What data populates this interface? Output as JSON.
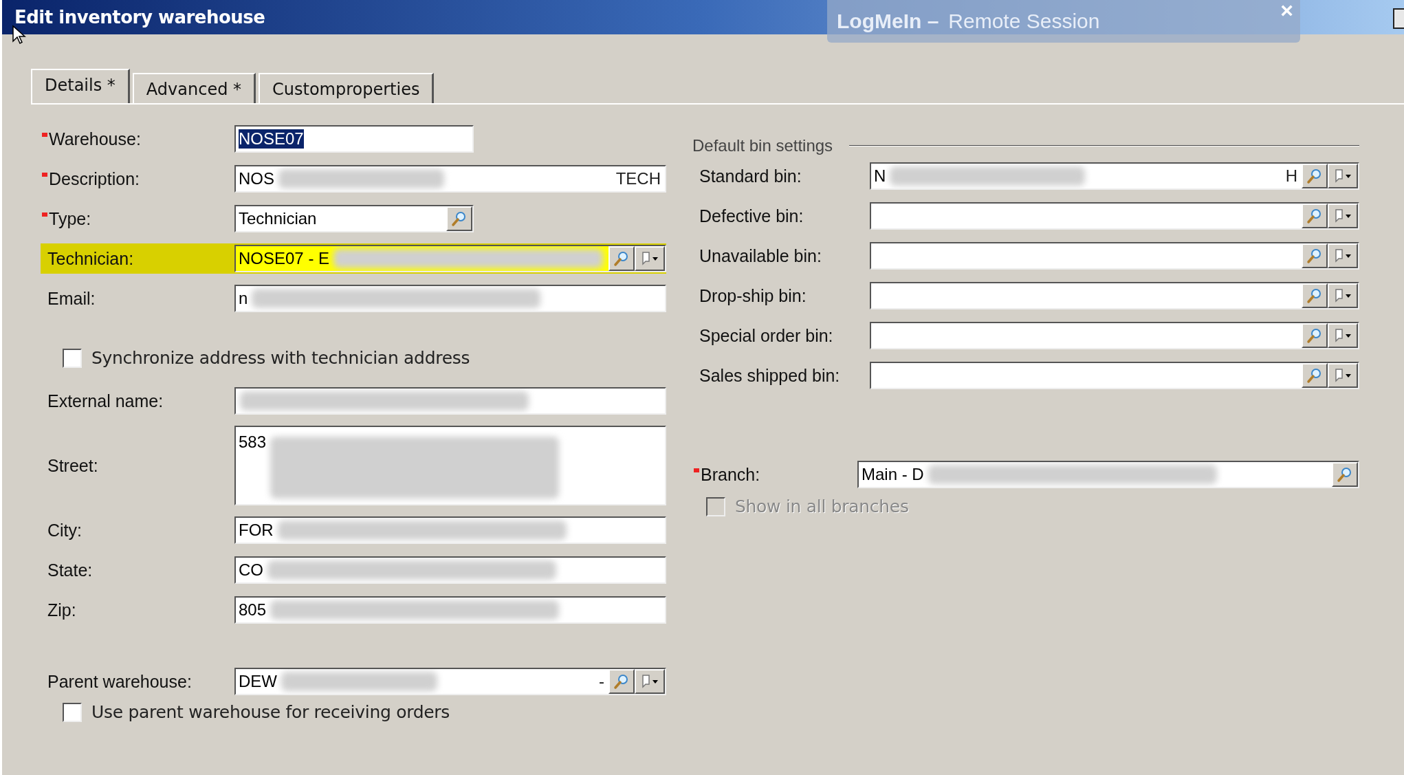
{
  "window": {
    "title": "Edit inventory warehouse"
  },
  "remote_overlay": {
    "brand": "LogMeIn –",
    "subtitle": "Remote Session",
    "close": "×"
  },
  "tabs": [
    {
      "label": "Details *",
      "selected": true
    },
    {
      "label": "Advanced *",
      "selected": false
    },
    {
      "label": "Customproperties",
      "selected": false
    }
  ],
  "primary_fields": [
    {
      "kind": "short",
      "label": "Warehouse:",
      "required": true,
      "value": "NOSE07",
      "value_selected": true
    },
    {
      "kind": "text",
      "label": "Description:",
      "required": true,
      "value": "NOS",
      "value_end": "TECH",
      "redacted": true
    },
    {
      "kind": "short_lookup",
      "label": "Type:",
      "required": true,
      "value": "Technician"
    },
    {
      "kind": "lookup_menu",
      "label": "Technician:",
      "value": "NOSE07 - E",
      "highlighted": true,
      "redacted": true
    },
    {
      "kind": "text",
      "label": "Email:",
      "value": "n",
      "redacted": true
    }
  ],
  "sync_checkbox": {
    "label": "Synchronize address with technician address",
    "checked": false
  },
  "address_fields": [
    {
      "kind": "text",
      "label": "External name:",
      "redacted": true
    },
    {
      "kind": "multiline",
      "label": "Street:",
      "value": "583",
      "redacted": true
    },
    {
      "kind": "text",
      "label": "City:",
      "value": "FOR",
      "redacted": true
    },
    {
      "kind": "text",
      "label": "State:",
      "value": "CO",
      "redacted": true
    },
    {
      "kind": "text",
      "label": "Zip:",
      "value": "805",
      "redacted": true
    }
  ],
  "parent_field": {
    "kind": "lookup_menu",
    "label": "Parent warehouse:",
    "value": "DEW",
    "value_end": "-",
    "redacted": true
  },
  "parent_checkbox": {
    "label": "Use parent warehouse for receiving orders",
    "checked": false
  },
  "bin_settings": {
    "title": "Default bin settings",
    "fields": [
      {
        "kind": "lookup_menu",
        "label": "Standard bin:",
        "value": "N",
        "value_end": "H",
        "redacted": true
      },
      {
        "kind": "lookup_menu",
        "label": "Defective bin:"
      },
      {
        "kind": "lookup_menu",
        "label": "Unavailable bin:"
      },
      {
        "kind": "lookup_menu",
        "label": "Drop-ship bin:"
      },
      {
        "kind": "lookup_menu",
        "label": "Special order bin:"
      },
      {
        "kind": "lookup_menu",
        "label": "Sales shipped bin:"
      }
    ]
  },
  "branch_field": {
    "kind": "lookup",
    "label": "Branch:",
    "required": true,
    "value": "Main - D",
    "redacted": true
  },
  "branch_checkbox": {
    "label": "Show in all branches",
    "checked": false,
    "disabled": true
  }
}
